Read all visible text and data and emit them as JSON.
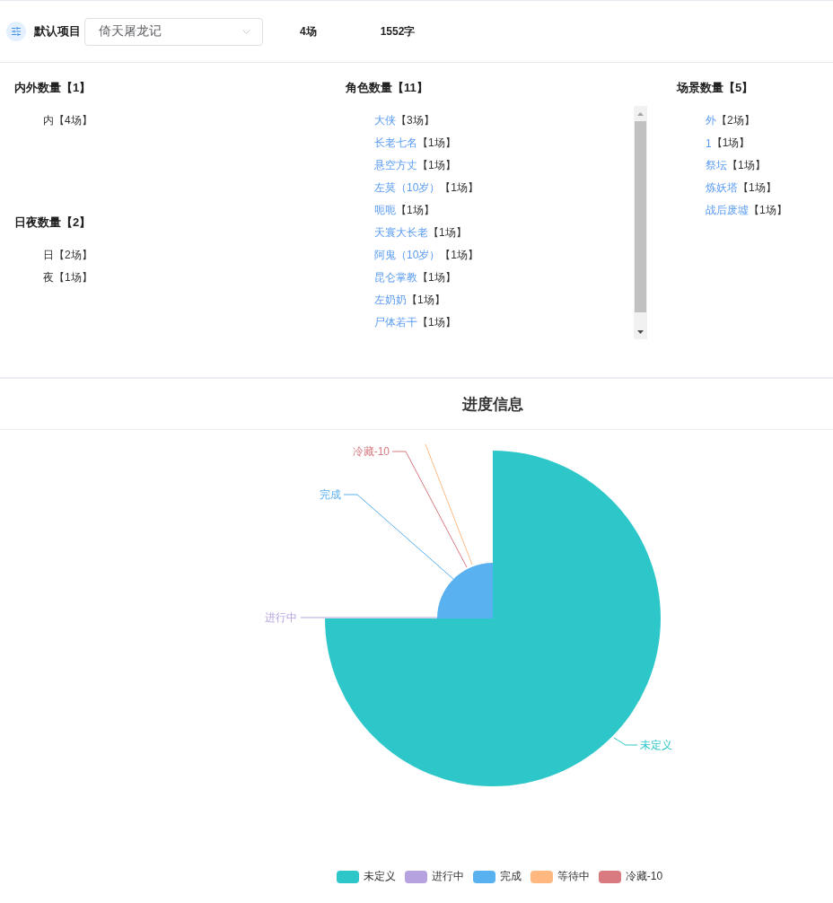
{
  "header": {
    "label": "默认项目",
    "project_select": {
      "value": "倚天屠龙记"
    },
    "scene_count": "4场",
    "word_count": "1552字"
  },
  "stats": {
    "columns": [
      {
        "scrollable": false,
        "groups": [
          {
            "title": "内外数量【1】",
            "kind": "plain",
            "items": [
              {
                "name": "内",
                "count": "【4场】"
              }
            ]
          },
          {
            "title": "日夜数量【2】",
            "kind": "plain",
            "items": [
              {
                "name": "日",
                "count": "【2场】"
              },
              {
                "name": "夜",
                "count": "【1场】"
              }
            ]
          }
        ]
      },
      {
        "scrollable": true,
        "groups": [
          {
            "title": "角色数量【11】",
            "kind": "link",
            "items": [
              {
                "name": "大侠",
                "count": "【3场】"
              },
              {
                "name": "长老七名",
                "count": "【1场】"
              },
              {
                "name": "悬空方丈",
                "count": "【1场】"
              },
              {
                "name": "左莫（10岁）",
                "count": "【1场】"
              },
              {
                "name": "呃呃",
                "count": "【1场】"
              },
              {
                "name": "天寰大长老",
                "count": "【1场】"
              },
              {
                "name": "阿鬼（10岁）",
                "count": "【1场】"
              },
              {
                "name": "昆仑掌教",
                "count": "【1场】"
              },
              {
                "name": "左奶奶",
                "count": "【1场】"
              },
              {
                "name": "尸体若干",
                "count": "【1场】"
              }
            ]
          }
        ]
      },
      {
        "scrollable": false,
        "groups": [
          {
            "title": "场景数量【5】",
            "kind": "link",
            "items": [
              {
                "name": "外",
                "count": "【2场】"
              },
              {
                "name": "1",
                "count": "【1场】"
              },
              {
                "name": "祭坛",
                "count": "【1场】"
              },
              {
                "name": "炼妖塔",
                "count": "【1场】"
              },
              {
                "name": "战后废墟",
                "count": "【1场】"
              }
            ]
          }
        ]
      }
    ]
  },
  "progress": {
    "title": "进度信息",
    "pie_labels": [
      {
        "text": "冷藏-10",
        "color": "#d87a80"
      },
      {
        "text": "完成",
        "color": "#5ab1ef"
      },
      {
        "text": "进行中",
        "color": "#b6a2de"
      },
      {
        "text": "未定义",
        "color": "#2ec7c9"
      }
    ],
    "legend": [
      {
        "name": "未定义",
        "color": "#2ec7c9"
      },
      {
        "name": "进行中",
        "color": "#b6a2de"
      },
      {
        "name": "完成",
        "color": "#5ab1ef"
      },
      {
        "name": "等待中",
        "color": "#ffb980"
      },
      {
        "name": "冷藏-10",
        "color": "#d87a80"
      }
    ]
  }
}
